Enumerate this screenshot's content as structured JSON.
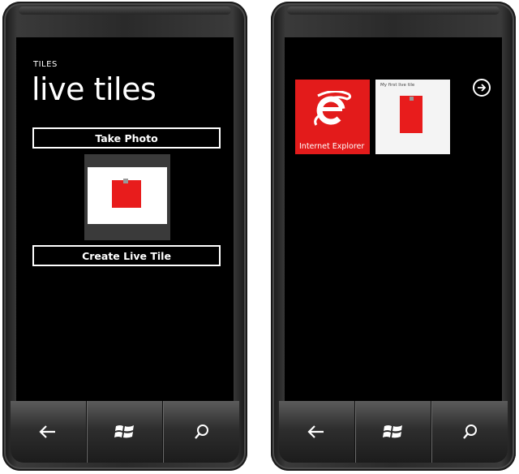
{
  "left_phone": {
    "app_title": "TILES",
    "page_title": "live tiles",
    "take_photo_label": "Take Photo",
    "create_tile_label": "Create Live Tile"
  },
  "right_phone": {
    "tiles": [
      {
        "label": "Internet Explorer",
        "icon": "internet-explorer-icon"
      },
      {
        "title": "My first live tile",
        "icon": "red-square-image"
      }
    ],
    "arrow_icon": "arrow-right-icon"
  },
  "hardware_buttons": [
    "back-icon",
    "windows-icon",
    "search-icon"
  ],
  "colors": {
    "accent_red": "#e31b1b",
    "screen_bg": "#000000",
    "text": "#ffffff"
  }
}
